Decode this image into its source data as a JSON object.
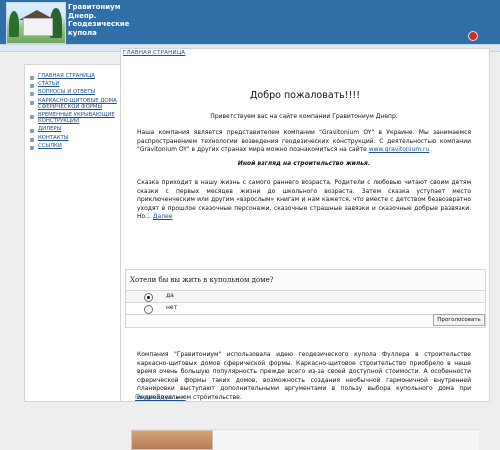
{
  "header": {
    "site_title": "Гравитониум Днепр. Геодезические купола",
    "logo_alt": "house-photo"
  },
  "sidebar": {
    "items": [
      {
        "label": "ГЛАВНАЯ СТРАНИЦА"
      },
      {
        "label": "СТАТЬИ"
      },
      {
        "label": "ВОПРОСЫ И ОТВЕТЫ"
      },
      {
        "label": "КАРКАСНО-ЩИТОВЫЕ ДОМА СФЕРИЧЕСКОЙ ФОРМЫ"
      },
      {
        "label": "ВРЕМЕННЫЕ УКРЫВАЮЩИЕ КОНСТРУКЦИИ"
      },
      {
        "label": "ДИЛЕРЫ"
      },
      {
        "label": "КОНТАКТЫ"
      },
      {
        "label": "ССЫЛКИ"
      }
    ]
  },
  "main": {
    "breadcrumb": "ГЛАВНАЯ СТРАНИЦА",
    "heading": "Добро пожаловать!!!!",
    "welcome": "Приветствуем вас на сайте компании Гравитониум Днепр.",
    "intro": "Наша компания является представителем компании \"Gravitonium OY\" в Украине. Мы занимаемся распространением технологии возведения геодезических конструкций. С деятельностью компании \"Gravitonium OY\" в других странах мира можно познакомиться на сайте",
    "intro_link": "www.gravitonium.ru",
    "subtitle": "Иной взгляд на строительство жилья.",
    "story": "Сказка приходит в нашу жизнь с самого раннего возраста. Родители с любовью читают своим детям сказки с первых месяцев жизни до школьного возраста. Затем сказка уступает место приключенческим или другим «взрослым» книгам и нам кажется, что вместе с детством безвозвратно уходят в прошлое сказочные персонажи, сказочные страшные завязки и сказочные добрые развязки. Но...",
    "story_link": "Далее",
    "poll": {
      "question": "Хотели бы вы жить в купольном доме?",
      "options": [
        "да",
        "нет"
      ],
      "selected": 0,
      "button": "Проголосовать"
    },
    "company": "Компания \"Гравитониум\" использовала идею геодезического купола Фуллера в строительстве каркасно-щитовых домов сферической формы. Каркасно-щитовое строительство приобрело в наше время очень большую популярность прежде всего из-за своей доступной стоимости. А особенности сферической формы таких домов, возможность создания необычной гармоничной внутренней планировки выступают дополнительными аргументами в пользу выбора купольного дома при индивидуальном строительстве.",
    "more_link": "Подробнее >>"
  },
  "colors": {
    "header_blue": "#2f6ea6",
    "link": "#1d4f91",
    "badge_red": "#d32b2b"
  }
}
